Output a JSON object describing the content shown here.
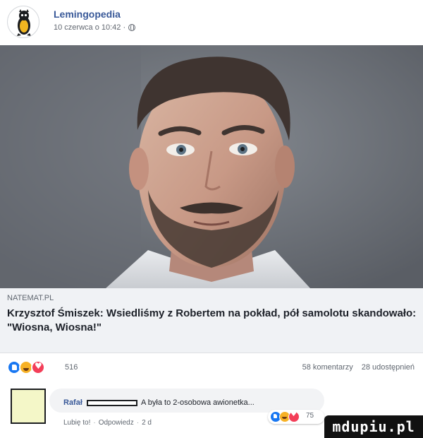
{
  "post": {
    "page_name": "Lemingopedia",
    "timestamp": "10 czerwca o 10:42 ·",
    "privacy_icon": "globe-icon"
  },
  "photo": {
    "subject": "man-portrait-photo"
  },
  "link_preview": {
    "domain": "NATEMAT.PL",
    "title": "Krzysztof Śmiszek: Wsiedliśmy z Robertem na pokład, pół samolotu skandowało: \"Wiosna, Wiosna!\""
  },
  "reactions": {
    "icons": [
      "like-icon",
      "haha-icon",
      "love-icon"
    ],
    "count": "516",
    "comments": "58 komentarzy",
    "shares": "28 udostępnień"
  },
  "comment": {
    "author": "Rafał",
    "text": "A była to 2-osobowa awionetka...",
    "like_action": "Lubię to!",
    "reply_action": "Odpowiedz",
    "age": "2 d",
    "reaction_count": "75"
  },
  "watermark": {
    "text": "mdupiu.pl"
  },
  "colors": {
    "link_blue": "#385898",
    "like_blue": "#1877f2",
    "love_red": "#f33e58",
    "haha_yellow": "#f7b125"
  }
}
